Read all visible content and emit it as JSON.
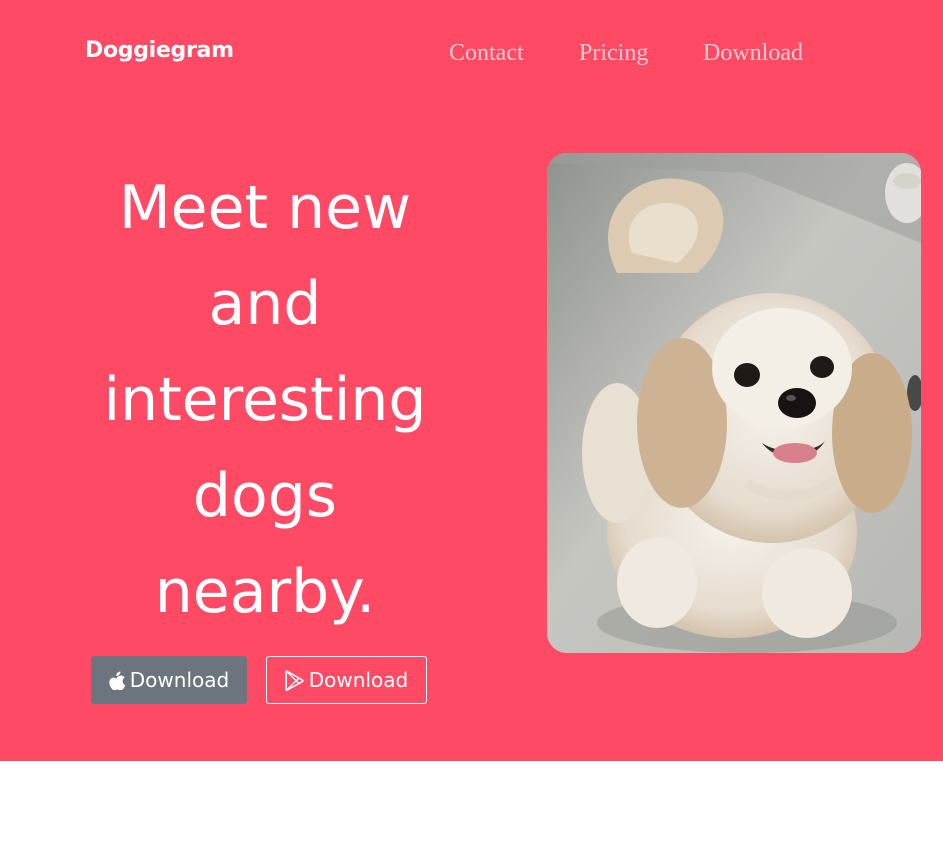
{
  "nav": {
    "brand": "Doggiegram",
    "links": [
      "Contact",
      "Pricing",
      "Download"
    ]
  },
  "hero": {
    "headline": "Meet new and interesting dogs nearby.",
    "buttons": {
      "apple": {
        "label": "Download",
        "icon": "apple-icon"
      },
      "play": {
        "label": "Download",
        "icon": "google-play-icon"
      }
    }
  },
  "colors": {
    "hero_background": "#ff4a66",
    "nav_link": "#f4c8cf",
    "apple_button": "#6c757d",
    "text": "#ffffff"
  }
}
